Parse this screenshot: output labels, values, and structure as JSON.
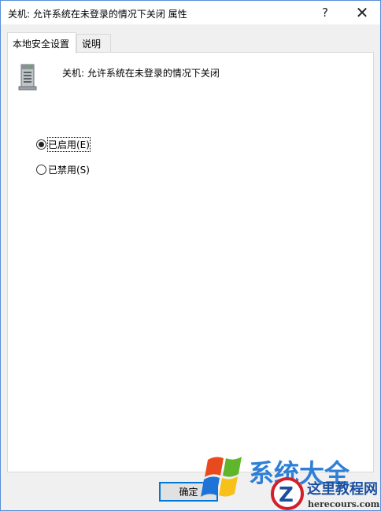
{
  "window": {
    "title": "关机: 允许系统在未登录的情况下关闭 属性",
    "help_glyph": "?",
    "close_glyph": "✕"
  },
  "tabs": [
    {
      "label": "本地安全设置",
      "active": true
    },
    {
      "label": "说明",
      "active": false
    }
  ],
  "policy": {
    "icon": "server-icon",
    "name": "关机: 允许系统在未登录的情况下关闭"
  },
  "options": [
    {
      "label": "已启用(E)",
      "checked": true
    },
    {
      "label": "已禁用(S)",
      "checked": false
    }
  ],
  "buttons": {
    "ok_label": "确定"
  },
  "watermark": {
    "brand_text": "系统大全",
    "site_name": "这里教程网",
    "site_url": "herecours.com"
  },
  "colors": {
    "accent": "#0078d7",
    "window_border": "#5a8fd6"
  }
}
